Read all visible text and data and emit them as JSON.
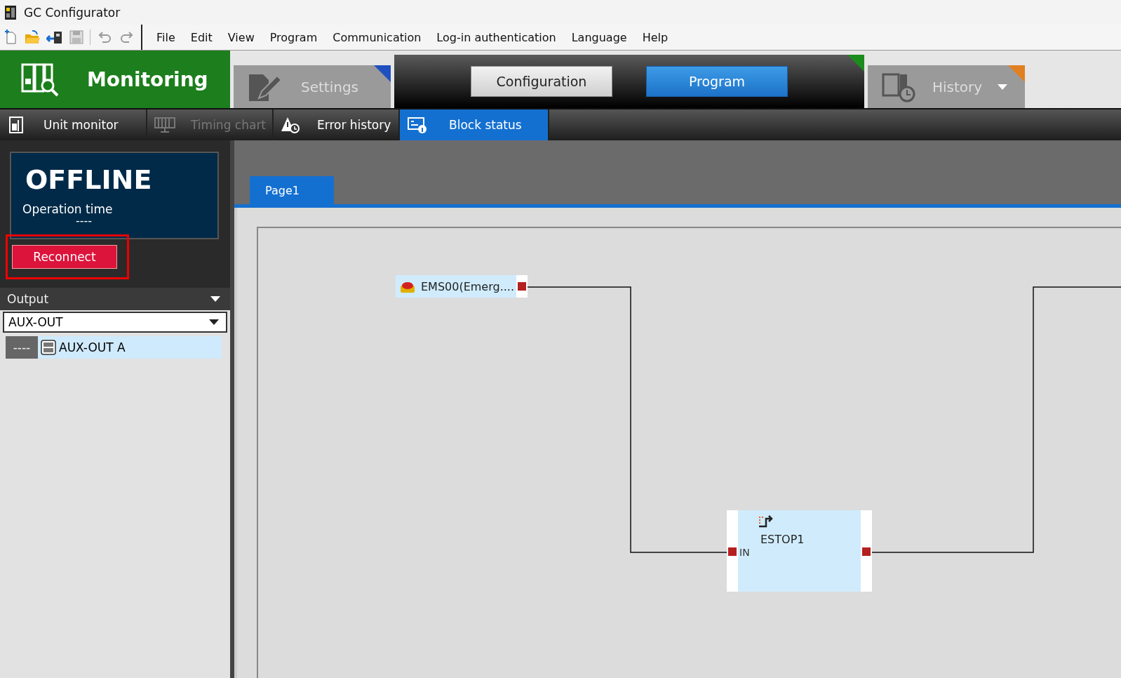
{
  "window": {
    "title": "GC Configurator"
  },
  "menu": [
    "File",
    "Edit",
    "View",
    "Program",
    "Communication",
    "Log-in authentication",
    "Language",
    "Help"
  ],
  "modes": {
    "monitoring": {
      "label": "Monitoring",
      "selected": true
    },
    "settings": {
      "label": "Settings",
      "selected": false
    },
    "edit_buttons": [
      {
        "label": "Configuration",
        "selected": false
      },
      {
        "label": "Program",
        "selected": true
      }
    ],
    "history": {
      "label": "History",
      "selected": false
    }
  },
  "sub_tabs": [
    {
      "label": "Unit monitor",
      "selected": false,
      "disabled": false
    },
    {
      "label": "Timing chart",
      "selected": false,
      "disabled": true
    },
    {
      "label": "Error history",
      "selected": false,
      "disabled": false
    },
    {
      "label": "Block status",
      "selected": true,
      "disabled": false
    }
  ],
  "status_panel": {
    "state": "OFFLINE",
    "operation_time_label": "Operation time",
    "operation_time": "----",
    "reconnect_button": "Reconnect"
  },
  "output": {
    "header": "Output",
    "dropdown_value": "AUX-OUT",
    "items": [
      {
        "status": "----",
        "label": "AUX-OUT A",
        "selected": true
      }
    ]
  },
  "page_tabs": [
    {
      "label": "Page1",
      "selected": true
    }
  ],
  "diagram": {
    "blocks": [
      {
        "kind": "input",
        "label": "EMS00(Emerg...."
      },
      {
        "kind": "function",
        "label": "ESTOP1",
        "port_label": "IN"
      }
    ]
  }
}
